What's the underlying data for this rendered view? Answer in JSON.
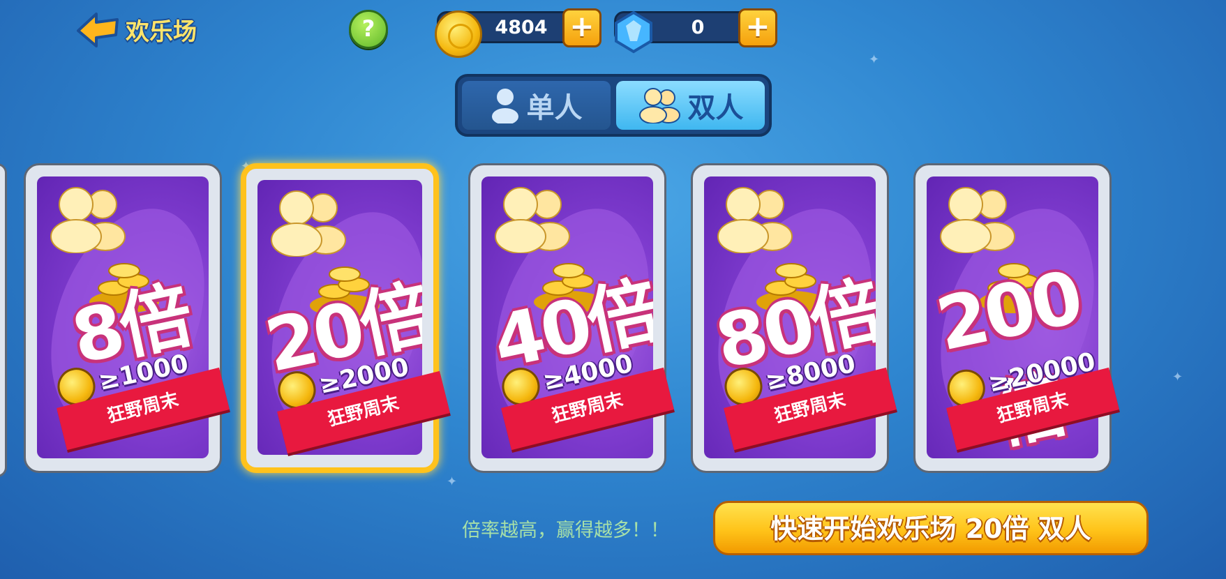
{
  "header": {
    "back_label": "欢乐场",
    "help_label": "?"
  },
  "wallet": {
    "coins": "4804",
    "gems": "0",
    "plus": "+"
  },
  "tabs": [
    {
      "label": "单人",
      "active": false
    },
    {
      "label": "双人",
      "active": true
    }
  ],
  "rooms": [
    {
      "multiplier": "8倍",
      "requirement": "≥1000",
      "tag": "狂野周末"
    },
    {
      "multiplier": "20倍",
      "requirement": "≥2000",
      "tag": "狂野周末",
      "selected": true
    },
    {
      "multiplier": "40倍",
      "requirement": "≥4000",
      "tag": "狂野周末"
    },
    {
      "multiplier": "80倍",
      "requirement": "≥8000",
      "tag": "狂野周末"
    },
    {
      "multiplier": "200倍",
      "requirement": "≥20000",
      "tag": "狂野周末"
    }
  ],
  "footer": {
    "hint": "倍率越高，赢得越多！！",
    "start_label": "快速开始欢乐场 20倍 双人"
  },
  "colors": {
    "accent": "#ffc21c",
    "ribbon": "#e8193f",
    "card_bg": "#7f3ccf"
  }
}
